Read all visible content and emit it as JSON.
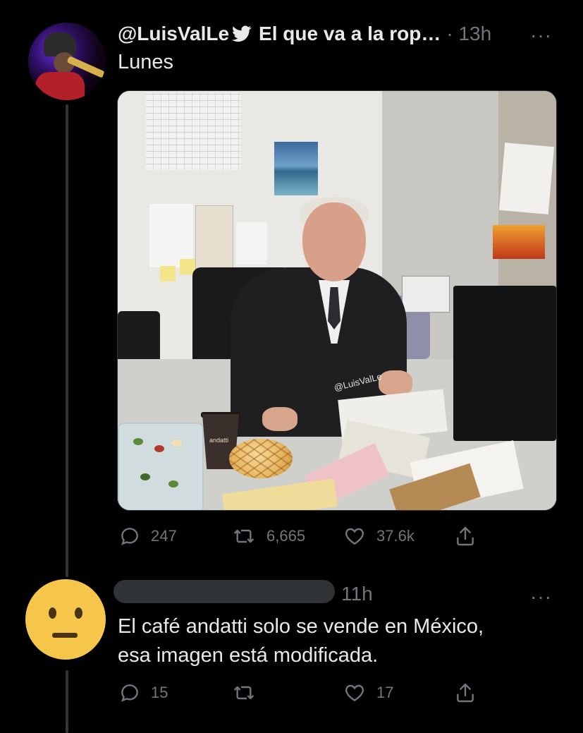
{
  "thread": {
    "tweet": {
      "handle": "@LuisValLe",
      "display_name": "El que va a la rop…",
      "separator": "·",
      "time": "13h",
      "more": "···",
      "text": "Lunes",
      "media": {
        "watermark": "@LuisValLe",
        "cup_brand": "andatti"
      },
      "actions": {
        "replies": "247",
        "retweets": "6,665",
        "likes": "37.6k"
      }
    },
    "reply": {
      "time": "11h",
      "more": "···",
      "text": "El café andatti solo se vende en México,\nesa imagen está modificada.",
      "actions": {
        "replies": "15",
        "retweets": "",
        "likes": "17"
      }
    }
  },
  "colors": {
    "background": "#000000",
    "text": "#e7e9ea",
    "secondary": "#71767b",
    "divider": "#333639"
  },
  "icons": [
    "verified-bird-icon",
    "reply-icon",
    "retweet-icon",
    "like-icon",
    "share-icon",
    "more-icon"
  ]
}
